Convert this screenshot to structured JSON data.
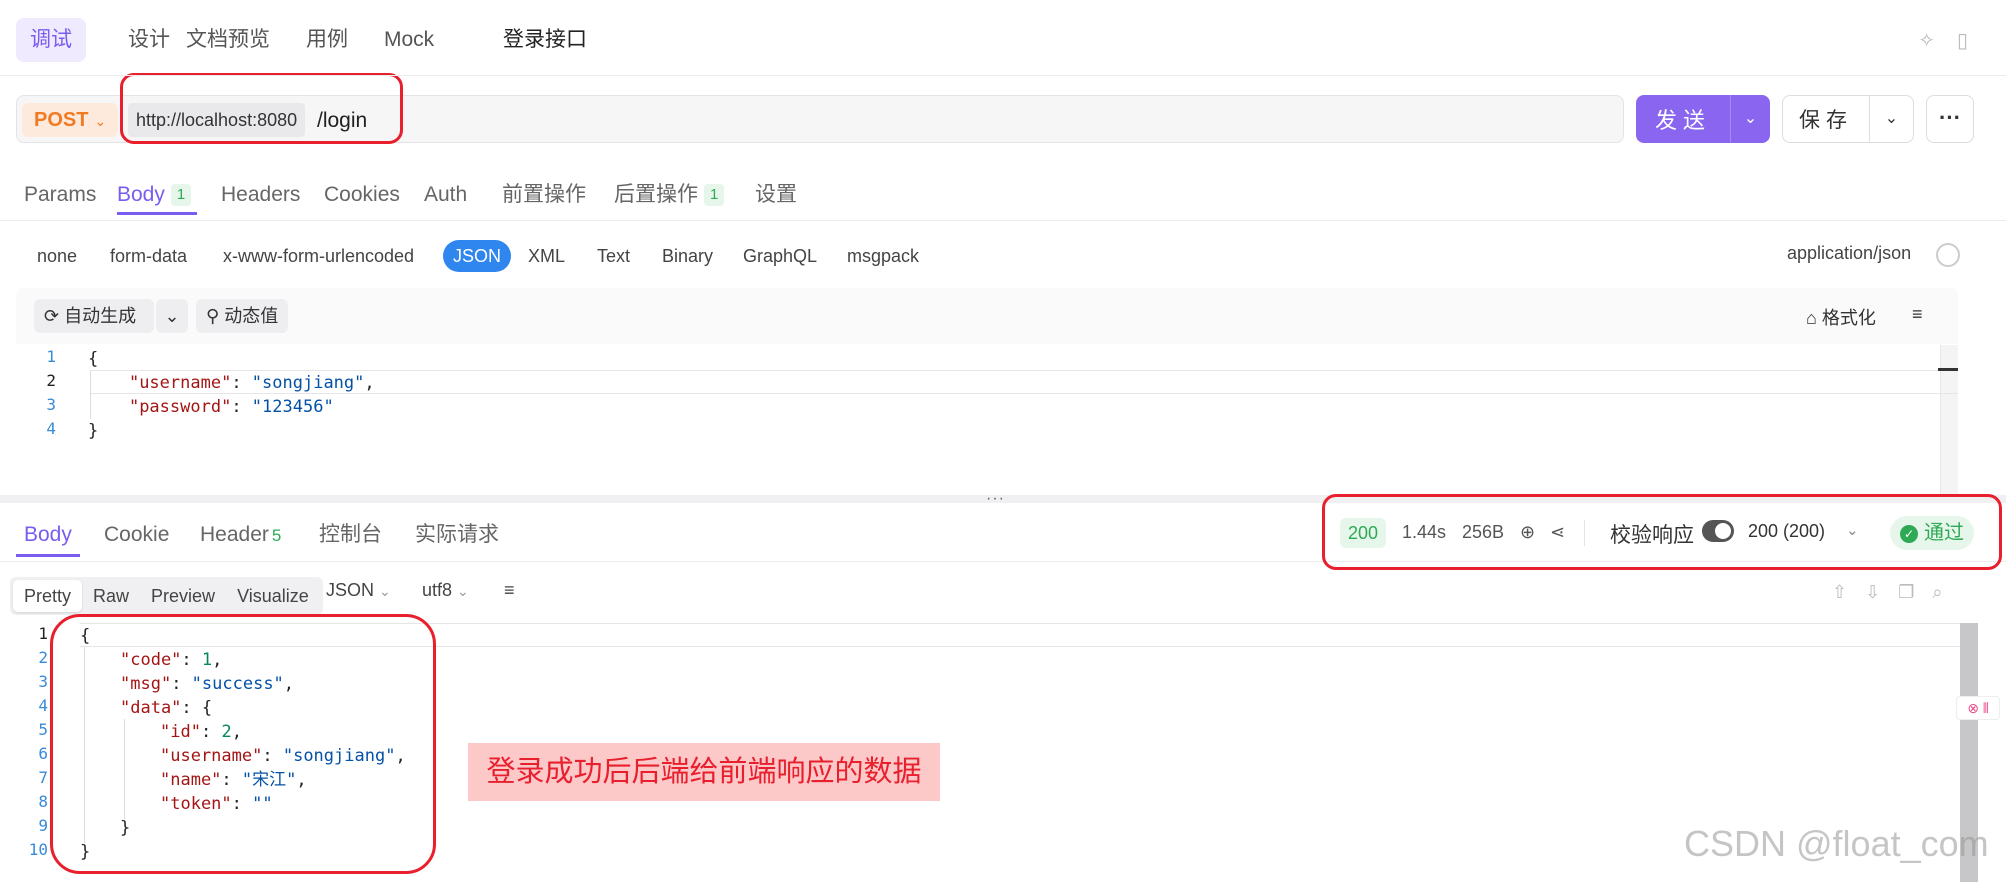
{
  "top_tabs": [
    "调试",
    "设计",
    "文档预览",
    "用例",
    "Mock"
  ],
  "api_title": "登录接口",
  "request": {
    "method": "POST",
    "host": "http://localhost:8080",
    "path": "/login",
    "send_label": "发送",
    "save_label": "保存",
    "more_label": "···"
  },
  "req_tabs": {
    "params": "Params",
    "body": "Body",
    "body_count": "1",
    "headers": "Headers",
    "cookies": "Cookies",
    "auth": "Auth",
    "pre": "前置操作",
    "post": "后置操作",
    "post_count": "1",
    "settings": "设置"
  },
  "body_types": [
    "none",
    "form-data",
    "x-www-form-urlencoded",
    "JSON",
    "XML",
    "Text",
    "Binary",
    "GraphQL",
    "msgpack"
  ],
  "content_type": "application/json",
  "toolbar": {
    "auto_generate": "自动生成",
    "dynamic_value": "动态值",
    "format": "格式化"
  },
  "request_body_lines": [
    {
      "num": "1",
      "text": "{"
    },
    {
      "num": "2",
      "key": "\"username\"",
      "value": "\"songjiang\"",
      "tail": ","
    },
    {
      "num": "3",
      "key": "\"password\"",
      "value": "\"123456\"",
      "tail": ""
    },
    {
      "num": "4",
      "text": "}"
    }
  ],
  "resp_tabs": {
    "body": "Body",
    "cookie": "Cookie",
    "header": "Header",
    "header_count": "5",
    "console": "控制台",
    "actual": "实际请求"
  },
  "response_meta": {
    "status": "200",
    "time": "1.44s",
    "size": "256B",
    "verify_label": "校验响应",
    "expected": "200 (200)",
    "result": "通过"
  },
  "view_modes": [
    "Pretty",
    "Raw",
    "Preview",
    "Visualize"
  ],
  "format_select": "JSON",
  "encoding_select": "utf8",
  "response_body_lines": [
    {
      "num": "1",
      "indent": 0,
      "text": "{"
    },
    {
      "num": "2",
      "indent": 1,
      "key": "\"code\"",
      "value": "1",
      "vtype": "n",
      "tail": ","
    },
    {
      "num": "3",
      "indent": 1,
      "key": "\"msg\"",
      "value": "\"success\"",
      "vtype": "s",
      "tail": ","
    },
    {
      "num": "4",
      "indent": 1,
      "key": "\"data\"",
      "value": "{",
      "vtype": "p",
      "tail": ""
    },
    {
      "num": "5",
      "indent": 2,
      "key": "\"id\"",
      "value": "2",
      "vtype": "n",
      "tail": ","
    },
    {
      "num": "6",
      "indent": 2,
      "key": "\"username\"",
      "value": "\"songjiang\"",
      "vtype": "s",
      "tail": ","
    },
    {
      "num": "7",
      "indent": 2,
      "key": "\"name\"",
      "value": "\"宋江\"",
      "vtype": "s",
      "tail": ","
    },
    {
      "num": "8",
      "indent": 2,
      "key": "\"token\"",
      "value": "\"\"",
      "vtype": "s",
      "tail": ""
    },
    {
      "num": "9",
      "indent": 1,
      "text": "}"
    },
    {
      "num": "10",
      "indent": 0,
      "text": "}"
    }
  ],
  "annotation": "登录成功后后端给前端响应的数据",
  "watermark": "CSDN @float_com",
  "colors": {
    "accent": "#7b5cf0",
    "method": "#f07b22",
    "success": "#2eaa55",
    "highlight_box": "#e8202e",
    "json_active": "#2f86ef"
  }
}
